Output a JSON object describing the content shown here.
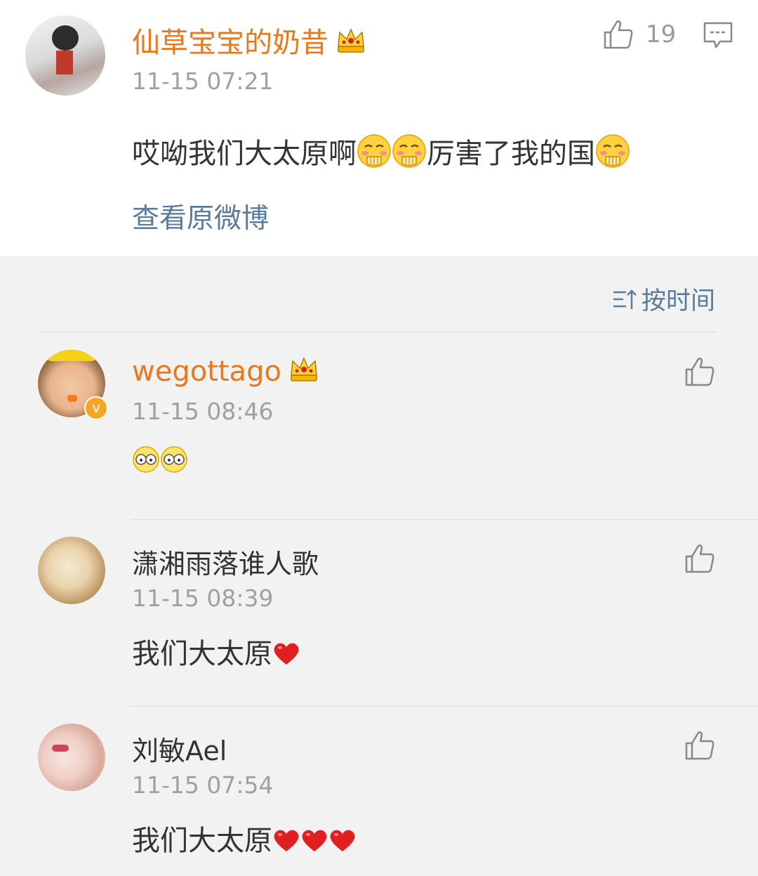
{
  "post": {
    "username": "仙草宝宝的奶昔",
    "timestamp": "11-15 07:21",
    "like_count": "19",
    "text_part1": "哎呦我们大太原啊",
    "text_part2": "厉害了我的国",
    "view_original_label": "查看原微博"
  },
  "sort": {
    "label": "按时间"
  },
  "comments": [
    {
      "username": "wegottago",
      "timestamp": "11-15 08:46",
      "badge": "v"
    },
    {
      "username": "潇湘雨落谁人歌",
      "timestamp": "11-15 08:39",
      "text": "我们大太原"
    },
    {
      "username": "刘敏Ael",
      "timestamp": "11-15 07:54",
      "text": "我们大太原"
    }
  ],
  "colors": {
    "username_vip": "#e8781e",
    "link": "#5b7b9a",
    "timestamp": "#a0a0a0",
    "heart": "#e02020"
  }
}
